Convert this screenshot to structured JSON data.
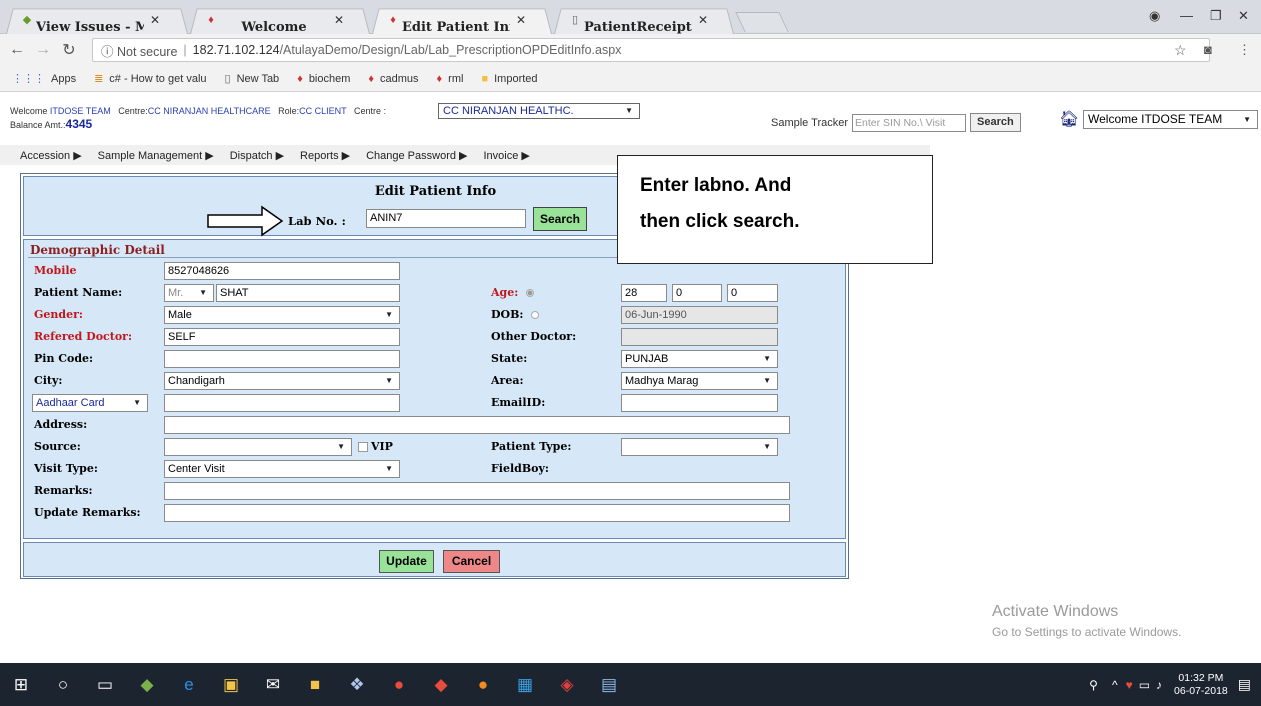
{
  "browser": {
    "tabs": [
      {
        "title": "View Issues - MantisBT",
        "fav": "◆"
      },
      {
        "title": "Welcome",
        "fav": "♦"
      },
      {
        "title": "Edit Patient Info",
        "fav": "♦"
      },
      {
        "title": "PatientReceipt.aspx",
        "fav": "▯"
      }
    ],
    "url_not_secure": "ⓘ Not secure",
    "url_host": "182.71.102.124",
    "url_path": "/AtulayaDemo/Design/Lab/Lab_PrescriptionOPDEditInfo.aspx",
    "bookmarks": [
      {
        "label": "Apps",
        "icon": "apps-grid-icon",
        "glyph": "⋮⋮⋮"
      },
      {
        "label": "c# - How to get valu",
        "icon": "stack-icon",
        "glyph": "≣"
      },
      {
        "label": "New Tab",
        "icon": "page-icon",
        "glyph": "▯"
      },
      {
        "label": "biochem",
        "icon": "site-icon",
        "glyph": "♦"
      },
      {
        "label": "cadmus",
        "icon": "site-icon",
        "glyph": "♦"
      },
      {
        "label": "rml",
        "icon": "site-icon",
        "glyph": "♦"
      },
      {
        "label": "Imported",
        "icon": "folder-icon",
        "glyph": "■"
      }
    ]
  },
  "header": {
    "welcome_prefix": "Welcome",
    "welcome_user": "ITDOSE TEAM",
    "centre_prefix": "Centre:",
    "centre_name": "CC NIRANJAN HEALTHCARE",
    "role_prefix": "Role:",
    "role_name": "CC CLIENT",
    "centre_select_label": "Centre :",
    "centre_select_value": "CC NIRANJAN HEALTHC.",
    "balance_label": "Balance Amt.:",
    "balance_value": "4345",
    "sample_tracker_label": "Sample Tracker",
    "sin_placeholder": "Enter SIN No.\\ Visit",
    "search_label": "Search",
    "welcome_select": "Welcome ITDOSE TEAM"
  },
  "menu": [
    "Accession ▶",
    "Sample Management ▶",
    "Dispatch ▶",
    "Reports ▶",
    "Change Password ▶",
    "Invoice ▶"
  ],
  "form": {
    "title": "Edit Patient Info",
    "labno_label": "Lab No. :",
    "labno_value": "ANIN7",
    "search_label": "Search",
    "section_title": "Demographic Detail",
    "mobile_label": "Mobile",
    "mobile_value": "8527048626",
    "patient_name_label": "Patient Name:",
    "title_value": "Mr.",
    "patient_name_value": "SHAT",
    "age_label": "Age:",
    "age_years": "28",
    "age_months": "0",
    "age_days": "0",
    "gender_label": "Gender:",
    "gender_value": "Male",
    "dob_label": "DOB:",
    "dob_value": "06-Jun-1990",
    "ref_doctor_label": "Refered Doctor:",
    "ref_doctor_value": "SELF",
    "other_doctor_label": "Other Doctor:",
    "pin_label": "Pin Code:",
    "state_label": "State:",
    "state_value": "PUNJAB",
    "city_label": "City:",
    "city_value": "Chandigarh",
    "area_label": "Area:",
    "area_value": "Madhya Marag",
    "id_type_value": "Aadhaar Card",
    "email_label": "EmailID:",
    "address_label": "Address:",
    "source_label": "Source:",
    "vip_label": "VIP",
    "patient_type_label": "Patient Type:",
    "visit_type_label": "Visit Type:",
    "visit_type_value": "Center Visit",
    "fieldboy_label": "FieldBoy:",
    "remarks_label": "Remarks:",
    "update_remarks_label": "Update Remarks:",
    "update_label": "Update",
    "cancel_label": "Cancel"
  },
  "callout": {
    "line1": "Enter  labno. And",
    "line2": "then click search."
  },
  "watermark": {
    "line1": "Activate Windows",
    "line2": "Go to Settings to activate Windows."
  },
  "taskbar": {
    "time": "01:32 PM",
    "date": "06-07-2018"
  },
  "colors": {
    "panel_bg": "#d6e8f7",
    "search_green": "#99e399",
    "cancel_red": "#ee8888",
    "label_red": "#c0171a"
  }
}
